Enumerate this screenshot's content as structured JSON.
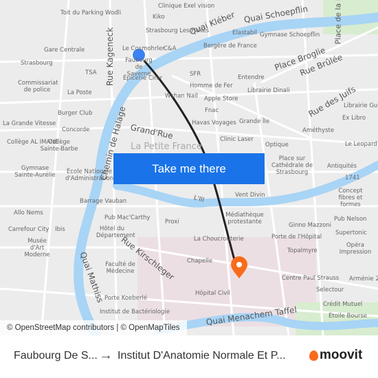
{
  "map": {
    "labels": [
      "Toit du Parking Wodli",
      "Kiko",
      "Clinique Exel vision",
      "Strasbourg Les Halles",
      "Elastabil",
      "Gymnase Schoepflin",
      "Gare Centrale",
      "Le Cosmohrler",
      "C&A",
      "Faubourg de Saverne",
      "Bergère de France",
      "Strasbourg",
      "TSA",
      "Épicerie Cirer",
      "SFR",
      "Entendre",
      "Commissariat de police",
      "La Poste",
      "Wshan Nail",
      "Homme de Fer",
      "Librairie Dinali",
      "Apple Store",
      "Fnac",
      "Burger Club",
      "Havas Voyages",
      "Grande Île",
      "La Grande Vitesse",
      "Concorde",
      "Librairie Gutenberg",
      "Ex Libro",
      "Améthyste",
      "Clinic Laser",
      "Optique",
      "Le Leopard",
      "Collège AL IMANE",
      "Collège Sainte-Barbe",
      "Gymnase Sainte-Aurélie",
      "École Nationale d'Administration",
      "Place sur Cathédrale de Strasbourg",
      "Antiquités",
      "1741",
      "Vent Divin",
      "Concept fibres et formes",
      "Barrage Vauban",
      "Allo Nems",
      "Pub Mac'Carthy",
      "Proxi",
      "Médiathèque protestante",
      "Ginno Mazzoni",
      "Pub Nelson",
      "Carrefour City",
      "Ibis",
      "Hôtel du Département",
      "Musée d'Art Moderne",
      "La Choucrouterie",
      "Porte de l'Hôpital",
      "Supertonic",
      "Opéra Impression",
      "Chapelle",
      "Topalmyre",
      "Faculté de Médecine",
      "Centre Paul Strauss",
      "Arménie 2",
      "Porte Koeberlé",
      "Hôpital Civil",
      "Selectour",
      "Crédit Mutuel",
      "Étoile Bourse",
      "Institut de Bactériologie",
      "La Petite France"
    ],
    "streets": [
      "Quai Kléber",
      "Quai Schoepflin",
      "Rue Kageneck",
      "Place Broglie",
      "Rue Brûlée",
      "Rue des Juifs",
      "Chemin de Halage",
      "Grand'Rue",
      "Rue Kirschleger",
      "Quai Mathiss",
      "Quai Menachem Taffel",
      "L'Ill",
      "Place de la République"
    ],
    "button": "Take me there",
    "attribution": "© OpenStreetMap contributors | © OpenMapTiles",
    "colors": {
      "water": "#a8d4f5",
      "route": "#222222",
      "origin": "#3b82f6",
      "destination": "#f96b1b",
      "button": "#1a73e8"
    }
  },
  "footer": {
    "from": "Faubourg De S...",
    "arrow": "→",
    "to": "Institut D'Anatomie Normale Et P...",
    "brand": "moovit"
  }
}
